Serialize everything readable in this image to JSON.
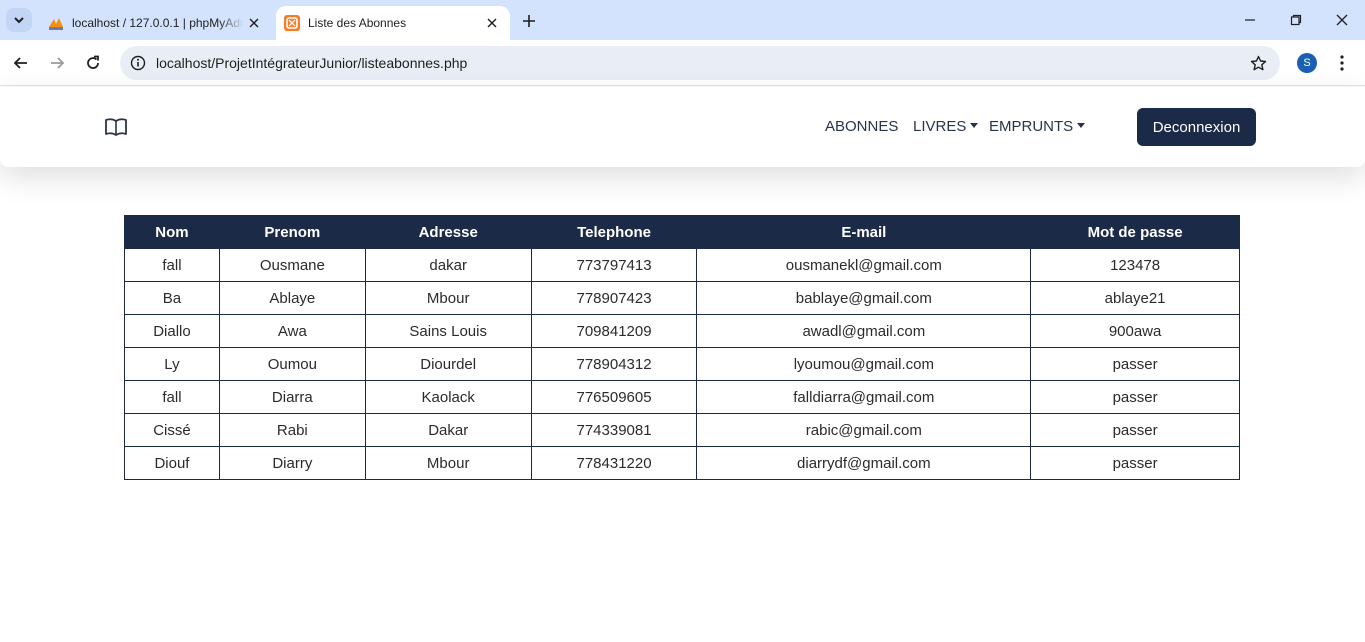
{
  "browser": {
    "tabs": [
      {
        "title": "localhost / 127.0.0.1 | phpMyAdmin",
        "favicon": "phpmyadmin-icon"
      },
      {
        "title": "Liste des Abonnes",
        "favicon": "xampp-icon"
      }
    ],
    "url": "localhost/ProjetIntégrateurJunior/listeabonnes.php",
    "profile_initial": "S"
  },
  "navbar": {
    "brand_icon": "book-icon",
    "links": [
      "ABONNES",
      "LIVRES",
      "EMPRUNTS"
    ],
    "logout_label": "Deconnexion"
  },
  "table": {
    "headers": [
      "Nom",
      "Prenom",
      "Adresse",
      "Telephone",
      "E-mail",
      "Mot de passe"
    ],
    "rows": [
      [
        "fall",
        "Ousmane",
        "dakar",
        "773797413",
        "ousmanekl@gmail.com",
        "123478"
      ],
      [
        "Ba",
        "Ablaye",
        "Mbour",
        "778907423",
        "bablaye@gmail.com",
        "ablaye21"
      ],
      [
        "Diallo",
        "Awa",
        "Sains Louis",
        "709841209",
        "awadl@gmail.com",
        "900awa"
      ],
      [
        "Ly",
        "Oumou",
        "Diourdel",
        "778904312",
        "lyoumou@gmail.com",
        "passer"
      ],
      [
        "fall",
        "Diarra",
        "Kaolack",
        "776509605",
        "falldiarra@gmail.com",
        "passer"
      ],
      [
        "Cissé",
        "Rabi",
        "Dakar",
        "774339081",
        "rabic@gmail.com",
        "passer"
      ],
      [
        "Diouf",
        "Diarry",
        "Mbour",
        "778431220",
        "diarrydf@gmail.com",
        "passer"
      ]
    ]
  },
  "colors": {
    "navy": "#1b2a47",
    "tabbar": "#d3e3fd"
  }
}
